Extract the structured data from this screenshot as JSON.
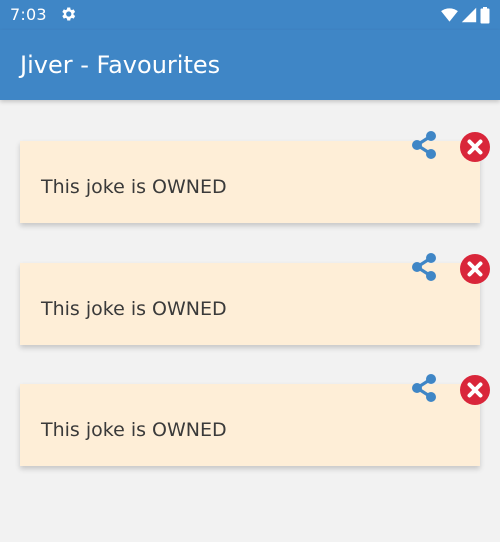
{
  "status_bar": {
    "time": "7:03",
    "icons": [
      "settings-icon",
      "wifi-icon",
      "signal-icon",
      "battery-icon"
    ]
  },
  "app_bar": {
    "title": "Jiver - Favourites",
    "color": "#3f86c6"
  },
  "favourites": [
    {
      "text": "This joke is OWNED"
    },
    {
      "text": "This joke is OWNED"
    },
    {
      "text": "This joke is OWNED"
    }
  ],
  "colors": {
    "card_background": "#feeed7",
    "share_icon": "#3f86c6",
    "delete_icon": "#d9263a",
    "page_background": "#f2f2f2"
  },
  "icons": {
    "share": "share-icon",
    "delete": "delete-icon"
  }
}
